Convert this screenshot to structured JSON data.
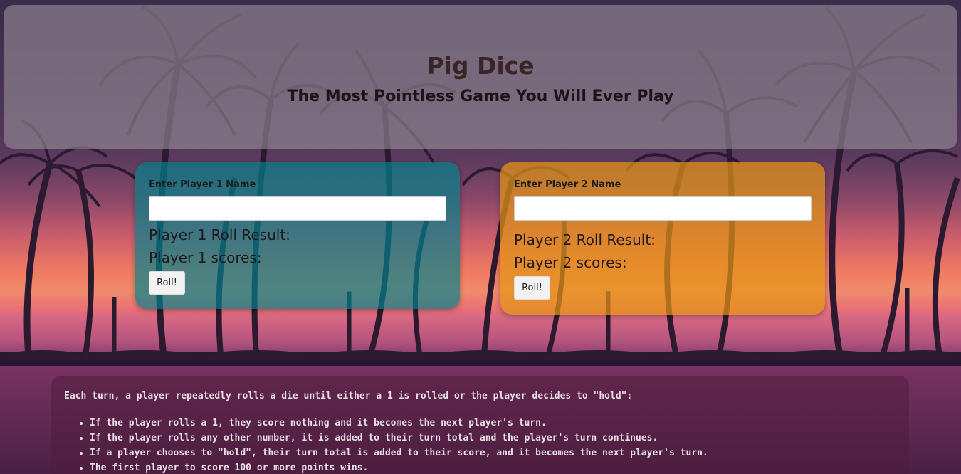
{
  "header": {
    "title": "Pig Dice",
    "subtitle": "The Most Pointless Game You Will Ever Play"
  },
  "player1": {
    "name_label": "Enter Player 1 Name",
    "name_value": "",
    "roll_result_label": "Player 1 Roll Result:",
    "scores_label": "Player 1 scores:",
    "roll_button": "Roll!",
    "panel_color": "#00828c"
  },
  "player2": {
    "name_label": "Enter Player 2 Name",
    "name_value": "",
    "roll_result_label": "Player 2 Roll Result:",
    "scores_label": "Player 2 scores:",
    "roll_button": "Roll!",
    "panel_color": "#e69614"
  },
  "rules": {
    "intro": "Each turn, a player repeatedly rolls a die until either a 1 is rolled or the player decides to \"hold\":",
    "items": [
      "If the player rolls a 1, they score nothing and it becomes the next player's turn.",
      "If the player rolls any other number, it is added to their turn total and the player's turn continues.",
      "If a player chooses to \"hold\", their turn total is added to their score, and it becomes the next player's turn.",
      "The first player to score 100 or more points wins."
    ]
  }
}
